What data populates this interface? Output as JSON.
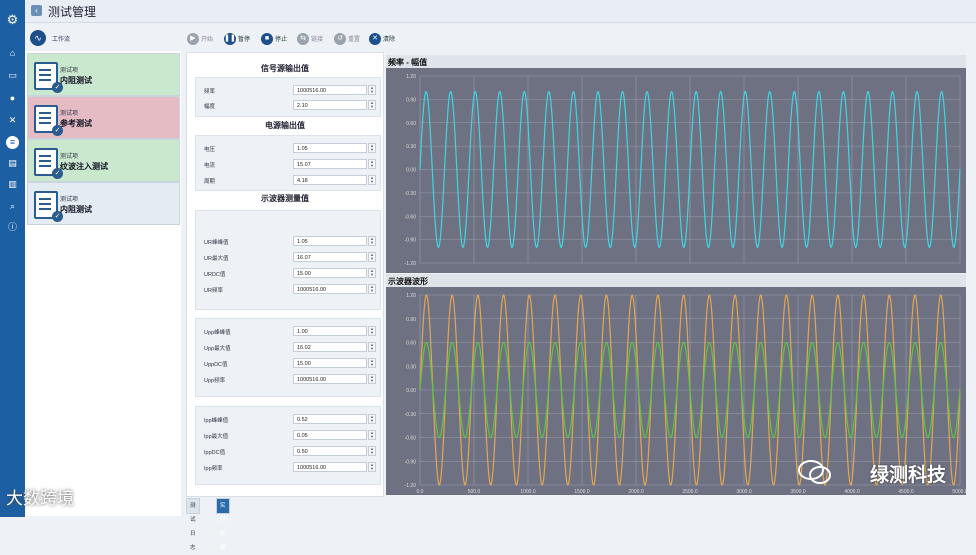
{
  "app": {
    "title": "测试管理",
    "workflow_label": "工作流"
  },
  "sidebar": {
    "icons": [
      "logo-icon",
      "home-icon",
      "device-icon",
      "chat-icon",
      "tools-icon",
      "report-icon",
      "document-icon",
      "chart-icon",
      "search-icon",
      "info-icon"
    ]
  },
  "tests": [
    {
      "kind": "测试项",
      "name": "内阻测试",
      "state": "done"
    },
    {
      "kind": "测试项",
      "name": "参考测试",
      "state": "fail"
    },
    {
      "kind": "测试项",
      "name": "纹波注入测试",
      "state": "done"
    },
    {
      "kind": "测试项",
      "name": "内阻测试",
      "state": "current"
    }
  ],
  "toolbar": [
    {
      "label": "开始",
      "icon": "play-icon",
      "enabled": false
    },
    {
      "label": "暂停",
      "icon": "pause-icon",
      "enabled": true
    },
    {
      "label": "停止",
      "icon": "stop-icon",
      "enabled": true
    },
    {
      "label": "链接",
      "icon": "link-icon",
      "enabled": false
    },
    {
      "label": "重置",
      "icon": "reset-icon",
      "enabled": false
    },
    {
      "label": "清除",
      "icon": "clear-icon",
      "enabled": true
    }
  ],
  "signal_source": {
    "title": "信号源输出值",
    "rows": [
      {
        "label": "频率",
        "value": "1000516.00"
      },
      {
        "label": "幅度",
        "value": "2.10"
      }
    ]
  },
  "power_source": {
    "title": "电源输出值",
    "rows": [
      {
        "label": "电压",
        "value": "1.05"
      },
      {
        "label": "电流",
        "value": "15.07"
      },
      {
        "label": "周期",
        "value": "4.18"
      }
    ]
  },
  "scope": {
    "title": "示波器测量值",
    "groups": [
      [
        {
          "label": "UR峰峰值",
          "value": "1.05"
        },
        {
          "label": "UR最大值",
          "value": "16.07"
        },
        {
          "label": "URDC值",
          "value": "15.00"
        },
        {
          "label": "UR频率",
          "value": "1000516.00"
        }
      ],
      [
        {
          "label": "Upp峰峰值",
          "value": "1.00"
        },
        {
          "label": "Upp最大值",
          "value": "16.02"
        },
        {
          "label": "UppDC值",
          "value": "15.00"
        },
        {
          "label": "Upp频率",
          "value": "1000516.00"
        }
      ],
      [
        {
          "label": "Ipp峰峰值",
          "value": "0.52"
        },
        {
          "label": "Ipp最大值",
          "value": "0.05"
        },
        {
          "label": "IppDC值",
          "value": "0.50"
        },
        {
          "label": "Ipp频率",
          "value": "1000516.00"
        }
      ]
    ]
  },
  "bottom_tabs": [
    {
      "label": "测试日志",
      "active": false
    },
    {
      "label": "实时数据",
      "active": true
    }
  ],
  "watermarks": {
    "right": "绿测科技",
    "left": "大数跨境"
  },
  "chart_data": [
    {
      "type": "line",
      "title": "频率 - 幅值",
      "ylim": [
        -1.2,
        1.2
      ],
      "yticks": [
        "1.20",
        "0.90",
        "0.60",
        "0.30",
        "0.00",
        "-0.30",
        "-0.60",
        "-0.90",
        "-1.20"
      ],
      "series": [
        {
          "color": "#3fd6e0",
          "amplitude": 1.0,
          "cycles": 22
        }
      ],
      "grid": true,
      "background": "#6e7182"
    },
    {
      "type": "line",
      "title": "示波器波形",
      "ylim": [
        -1.2,
        1.2
      ],
      "yticks": [
        "1.20",
        "0.90",
        "0.60",
        "0.30",
        "0.00",
        "-0.30",
        "-0.60",
        "-0.90",
        "-1.20"
      ],
      "xticks": [
        "0.0",
        "500.0",
        "1000.0",
        "1500.0",
        "2000.0",
        "2500.0",
        "3000.0",
        "3500.0",
        "4000.0",
        "4500.0",
        "5000.0"
      ],
      "series": [
        {
          "color": "#e3a653",
          "amplitude": 1.2,
          "cycles": 21
        },
        {
          "color": "#5dc444",
          "amplitude": 0.6,
          "cycles": 21
        }
      ],
      "grid": true,
      "background": "#6e7182"
    }
  ]
}
